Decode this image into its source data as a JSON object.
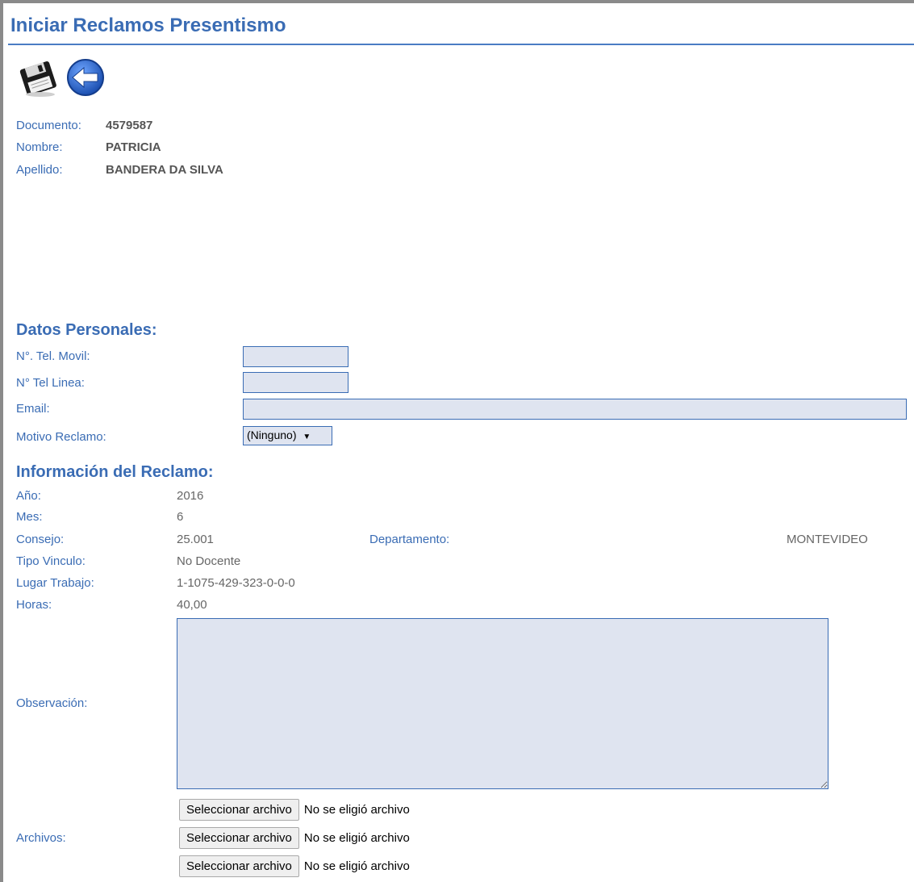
{
  "page": {
    "title": "Iniciar Reclamos Presentismo"
  },
  "toolbar": {
    "save_icon": "floppy-save-icon",
    "back_icon": "back-arrow-icon"
  },
  "person": {
    "documento_label": "Documento:",
    "documento_value": "4579587",
    "nombre_label": "Nombre:",
    "nombre_value": "PATRICIA",
    "apellido_label": "Apellido:",
    "apellido_value": "BANDERA DA SILVA"
  },
  "datos_personales": {
    "title": "Datos Personales:",
    "movil_label": "N°. Tel. Movil:",
    "movil_value": "",
    "linea_label": "N° Tel Linea:",
    "linea_value": "",
    "email_label": "Email:",
    "email_value": "",
    "motivo_label": "Motivo Reclamo:",
    "motivo_selected": "(Ninguno)"
  },
  "reclamo": {
    "title": "Información del Reclamo:",
    "anio_label": "Año:",
    "anio_value": "2016",
    "mes_label": "Mes:",
    "mes_value": "6",
    "consejo_label": "Consejo:",
    "consejo_value": "25.001",
    "departamento_label": "Departamento:",
    "departamento_value": "MONTEVIDEO",
    "tipo_label": "Tipo Vinculo:",
    "tipo_value": "No Docente",
    "lugar_label": "Lugar Trabajo:",
    "lugar_value": "1-1075-429-323-0-0-0",
    "horas_label": "Horas:",
    "horas_value": "40,00",
    "observacion_label": "Observación:",
    "observacion_value": ""
  },
  "archivos": {
    "label": "Archivos:",
    "files": [
      {
        "button": "Seleccionar archivo",
        "status": "No se eligió archivo"
      },
      {
        "button": "Seleccionar archivo",
        "status": "No se eligió archivo"
      },
      {
        "button": "Seleccionar archivo",
        "status": "No se eligió archivo"
      }
    ]
  }
}
